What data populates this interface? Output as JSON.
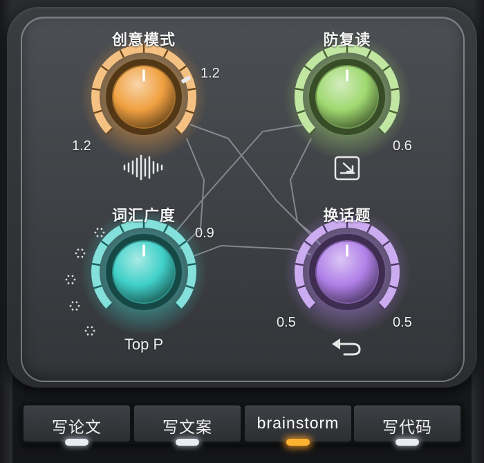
{
  "accent_colors": {
    "creativity": "#f0a040",
    "anti_repeat": "#9fd870",
    "vocabulary": "#40d0c8",
    "topic_change": "#b080e8",
    "active_led": "#ffb230"
  },
  "knobs": {
    "creativity": {
      "title": "创意模式",
      "value": 1.2,
      "marker_label": "1.2",
      "min_label": "1.2",
      "icon": "waveform-icon"
    },
    "anti_repeat": {
      "title": "防复读",
      "value": 0.6,
      "value_label": "0.6",
      "icon": "download-box-icon"
    },
    "vocabulary": {
      "title": "词汇广度",
      "value": 0.9,
      "value_label": "0.9",
      "sub_label": "Top P",
      "icon": "dots-spread-icon"
    },
    "topic_change": {
      "title": "换话题",
      "value": 0.5,
      "left_label": "0.5",
      "right_label": "0.5",
      "icon": "return-arrow-icon"
    }
  },
  "modes": {
    "items": [
      {
        "label": "写论文",
        "active": false
      },
      {
        "label": "写文案",
        "active": false
      },
      {
        "label": "brainstorm",
        "active": true
      },
      {
        "label": "写代码",
        "active": false
      }
    ]
  }
}
